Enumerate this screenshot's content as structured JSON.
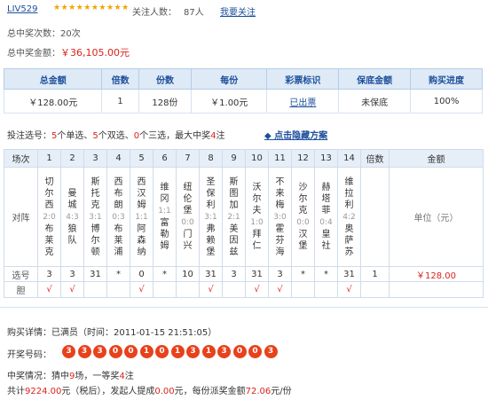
{
  "header": {
    "username": "LIV529",
    "stars": "★★★★★★★★★★",
    "follow_label": "关注人数：",
    "follow_count": "87人",
    "follow_button": "我要关注"
  },
  "summary": {
    "wins_label": "总中奖次数：",
    "wins_value": "20次",
    "amount_label": "总中奖金额：",
    "amount_value": "￥36,105.00元"
  },
  "purchase": {
    "headers": [
      "总金额",
      "倍数",
      "份数",
      "每份",
      "彩票标识",
      "保底金额",
      "购买进度"
    ],
    "total": "￥128.00元",
    "multiple": "1",
    "shares": "128份",
    "per_share": "￥1.00元",
    "ticket_status": "已出票",
    "guarantee": "未保底",
    "progress": "100%"
  },
  "selection": {
    "p1": "投注选号：",
    "n1": "5",
    "p2": "个单选、",
    "n2": "5",
    "p3": "个双选、",
    "n3": "0",
    "p4": "个三选，最大中奖",
    "n4": "4",
    "p5": "注",
    "toggle": "点击隐藏方案"
  },
  "grid": {
    "col_header_label": "场次",
    "numbers": [
      "1",
      "2",
      "3",
      "4",
      "5",
      "6",
      "7",
      "8",
      "9",
      "10",
      "11",
      "12",
      "13",
      "14"
    ],
    "multiple_header": "倍数",
    "amount_header": "金额",
    "row_label_match": "对阵",
    "matches": [
      {
        "home": "切尔西",
        "score": "2:0",
        "away": "布莱克"
      },
      {
        "home": "曼城",
        "score": "4:3",
        "away": "狼队"
      },
      {
        "home": "斯托克",
        "score": "3:1",
        "away": "博尔顿"
      },
      {
        "home": "西布朗",
        "score": "0:3",
        "away": "布莱浦"
      },
      {
        "home": "西汉姆",
        "score": "1:1",
        "away": "阿森纳"
      },
      {
        "home": "维冈",
        "score": "1:1",
        "away": "富勒姆"
      },
      {
        "home": "纽伦堡",
        "score": "0:0",
        "away": "门兴"
      },
      {
        "home": "圣保利",
        "score": "3:1",
        "away": "弗赖堡"
      },
      {
        "home": "斯图加",
        "score": "2:1",
        "away": "美因兹"
      },
      {
        "home": "沃尔夫",
        "score": "1:0",
        "away": "拜仁"
      },
      {
        "home": "不来梅",
        "score": "3:0",
        "away": "霍芬海"
      },
      {
        "home": "沙尔克",
        "score": "0:0",
        "away": "汉堡"
      },
      {
        "home": "赫塔菲",
        "score": "0:4",
        "away": "皇社"
      },
      {
        "home": "维拉利",
        "score": "4:2",
        "away": "奥萨苏"
      }
    ],
    "unit": "单位（元）",
    "row_label_pick": "选号",
    "picks": [
      "3",
      "3",
      "31",
      "*",
      "0",
      "*",
      "10",
      "31",
      "3",
      "31",
      "3",
      "*",
      "*",
      "31"
    ],
    "pick_multiple": "1",
    "pick_amount": "￥128.00",
    "row_label_banker": "胆",
    "bankers": [
      "√",
      "√",
      "",
      "",
      "√",
      "",
      "",
      "√",
      "",
      "√",
      "√",
      "",
      "",
      "√"
    ]
  },
  "details": {
    "buy_detail": "购买详情：已满员（时间：2011-01-15 21:51:05）",
    "draw_label": "开奖号码：",
    "draw_numbers": [
      "3",
      "3",
      "3",
      "0",
      "0",
      "1",
      "0",
      "1",
      "3",
      "1",
      "3",
      "0",
      "0",
      "3"
    ],
    "result_p1": "中奖情况：猜中",
    "result_n1": "9",
    "result_p2": "场，一等奖",
    "result_n2": "4",
    "result_p3": "注",
    "payout_p1": "共计",
    "payout_n1": "9224.00",
    "payout_p2": "元（税后），发起人提成",
    "payout_n2": "0.00",
    "payout_p3": "元，每份派奖金额",
    "payout_n3": "72.06",
    "payout_p4": "元/份"
  },
  "colors": {
    "accent_red": "#d9241c",
    "link_blue": "#1d4f9b",
    "ball_orange": "#e8411b",
    "header_bg": "#dfeaf7"
  }
}
